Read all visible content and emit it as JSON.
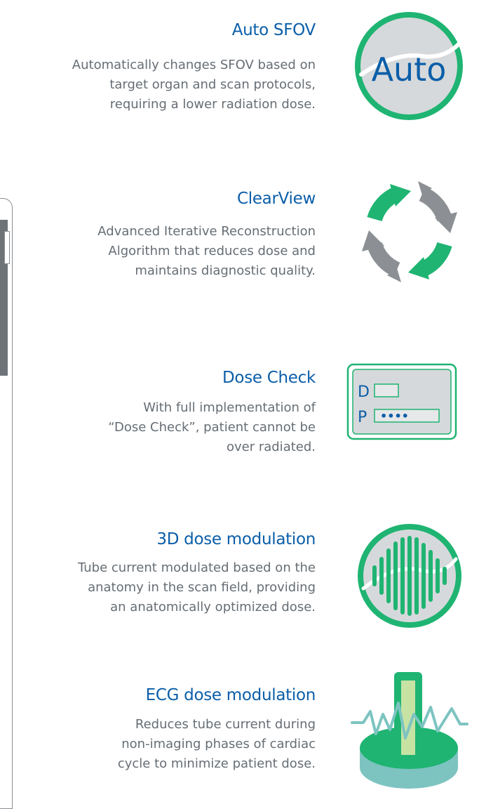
{
  "features": [
    {
      "id": "auto-sfov",
      "title": "Auto SFOV",
      "description": [
        "Automatically changes SFOV based on",
        "target organ and scan protocols,",
        "requiring a lower radiation dose."
      ],
      "icon": "auto-badge-icon",
      "icon_text": "Auto"
    },
    {
      "id": "clearview",
      "title": "ClearView",
      "description": [
        "Advanced Iterative Reconstruction",
        "Algorithm that reduces dose and",
        "maintains diagnostic quality."
      ],
      "icon": "circular-arrows-icon"
    },
    {
      "id": "dose-check",
      "title": "Dose Check",
      "description": [
        "With full implementation of",
        "“Dose Check”, patient cannot be",
        "over radiated."
      ],
      "icon": "dose-panel-icon",
      "icon_labels": [
        "D",
        "P"
      ],
      "icon_dots": "••••"
    },
    {
      "id": "3d-dose-modulation",
      "title": "3D dose modulation",
      "description": [
        "Tube current modulated based on the",
        "anatomy in the scan field, providing",
        "an anatomically optimized dose."
      ],
      "icon": "waveform-circle-icon"
    },
    {
      "id": "ecg-dose-modulation",
      "title": "ECG dose modulation",
      "description": [
        "Reduces tube current during",
        "non-imaging phases of cardiac",
        "cycle to minimize patient dose."
      ],
      "icon": "ecg-platform-icon"
    }
  ],
  "colors": {
    "title_blue": "#0b5ea8",
    "body_gray": "#666d74",
    "accent_green": "#1fb472",
    "icon_gray": "#8c9094",
    "light_gray": "#d6d9dc",
    "teal": "#7dc4c1",
    "light_green": "#c6e3a4"
  }
}
